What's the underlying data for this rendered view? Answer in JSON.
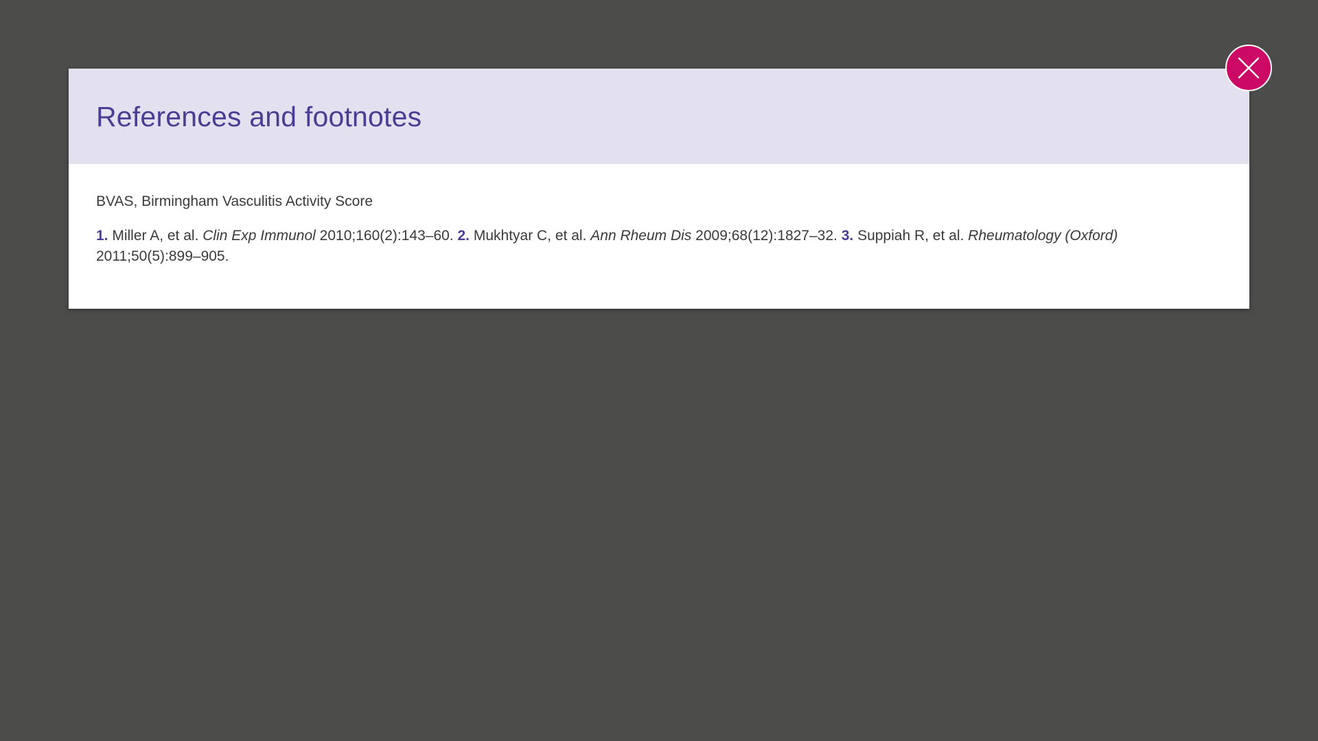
{
  "colors": {
    "backdrop": "#4c4c4a",
    "header_bg": "#e3e1ef",
    "title": "#4b3d94",
    "close_button": "#cc0a66"
  },
  "modal": {
    "title": "References and footnotes",
    "abbreviation": "BVAS, Birmingham Vasculitis Activity Score",
    "references": [
      {
        "number": "1.",
        "authors": "Miller A, et al.",
        "journal": "Clin Exp Immunol",
        "citation": "2010;160(2):143–60."
      },
      {
        "number": "2.",
        "authors": "Mukhtyar C, et al.",
        "journal": "Ann Rheum Dis",
        "citation": "2009;68(12):1827–32."
      },
      {
        "number": "3.",
        "authors": "Suppiah R, et al.",
        "journal": "Rheumatology (Oxford)",
        "citation": "2011;50(5):899–905."
      }
    ]
  },
  "close_button": {
    "icon": "close-icon"
  }
}
